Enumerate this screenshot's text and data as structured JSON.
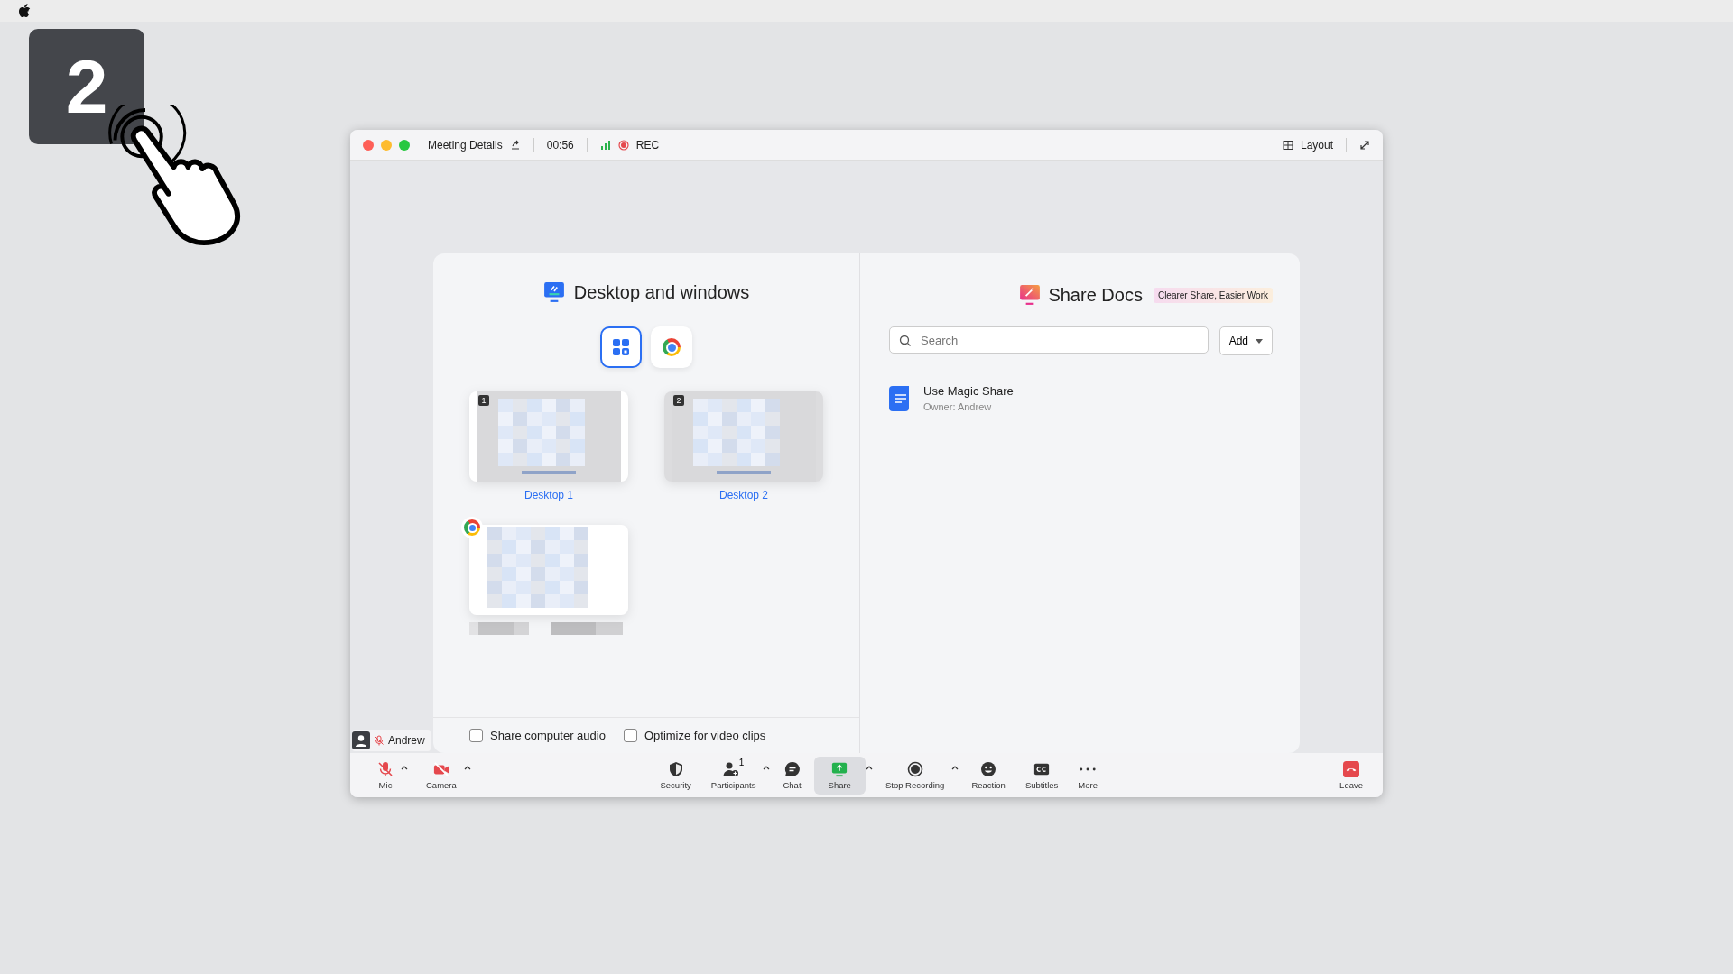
{
  "step_badge": "2",
  "window": {
    "meeting_details": "Meeting Details",
    "timer": "00:56",
    "recording": "REC",
    "layout": "Layout"
  },
  "share_dialog": {
    "left": {
      "title": "Desktop and windows",
      "filters": [
        {
          "kind": "all",
          "selected": true
        },
        {
          "kind": "chrome",
          "selected": false
        }
      ],
      "items": [
        {
          "kind": "desktop",
          "badge": "1",
          "label": "Desktop 1"
        },
        {
          "kind": "desktop",
          "badge": "2",
          "label": "Desktop 2"
        },
        {
          "kind": "window"
        }
      ],
      "options": [
        {
          "label": "Share computer audio",
          "checked": false
        },
        {
          "label": "Optimize for video clips",
          "checked": false
        }
      ]
    },
    "right": {
      "title": "Share Docs",
      "tag": "Clearer Share, Easier Work",
      "search": {
        "placeholder": "Search"
      },
      "add_button": "Add",
      "docs": [
        {
          "title": "Use Magic Share",
          "owner": "Owner: Andrew"
        }
      ]
    }
  },
  "participant_tag": {
    "name": "Andrew",
    "muted": true
  },
  "toolbar": {
    "left": [
      {
        "kind": "mic",
        "label": "Mic",
        "off": true,
        "caret": true
      },
      {
        "kind": "camera",
        "label": "Camera",
        "off": true,
        "caret": true
      }
    ],
    "center": [
      {
        "kind": "security",
        "label": "Security",
        "selected": false,
        "caret": false
      },
      {
        "kind": "participants",
        "label": "Participants",
        "count": "1",
        "selected": false,
        "caret": true
      },
      {
        "kind": "chat",
        "label": "Chat",
        "selected": false,
        "caret": false
      },
      {
        "kind": "share",
        "label": "Share",
        "selected": true,
        "caret": true
      },
      {
        "kind": "record",
        "label": "Stop Recording",
        "selected": false,
        "caret": true
      },
      {
        "kind": "reaction",
        "label": "Reaction",
        "selected": false,
        "caret": false
      },
      {
        "kind": "subtitles",
        "label": "Subtitles",
        "selected": false,
        "caret": false
      },
      {
        "kind": "more",
        "label": "More",
        "selected": false,
        "caret": false
      }
    ],
    "leave": "Leave"
  }
}
